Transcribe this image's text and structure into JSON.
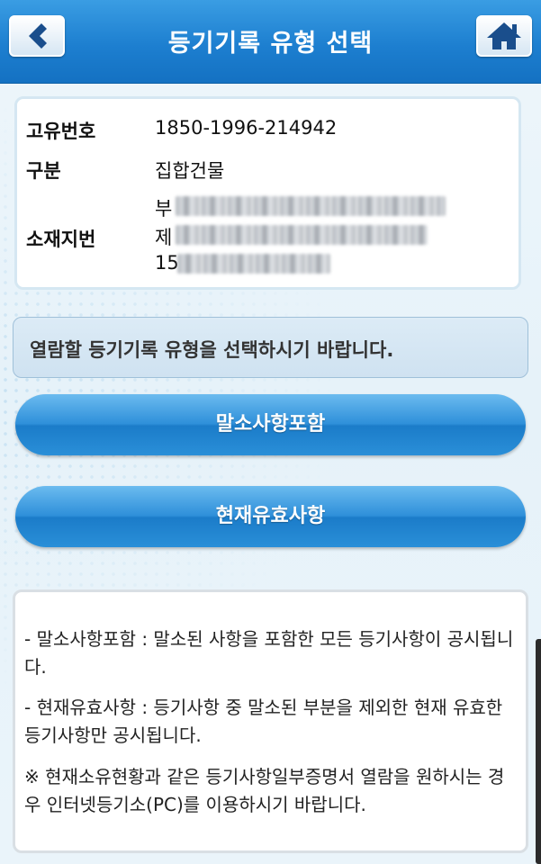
{
  "header": {
    "title": "등기기록 유형 선택",
    "back_icon": "chevron-left-icon",
    "home_icon": "home-icon"
  },
  "info": {
    "id_label": "고유번호",
    "id_value": "1850-1996-214942",
    "type_label": "구분",
    "type_value": "집합건물",
    "address_label": "소재지번",
    "address_line1_prefix": "부",
    "address_line2_prefix": "제",
    "address_line3_prefix": "15"
  },
  "notice": {
    "text": "열람할 등기기록 유형을 선택하시기 바랍니다."
  },
  "buttons": {
    "include_cancelled": "말소사항포함",
    "current_valid": "현재유효사항"
  },
  "description": {
    "para1": "- 말소사항포함 : 말소된 사항을 포함한 모든 등기사항이 공시됩니다.",
    "para2": "- 현재유효사항 : 등기사항 중 말소된 부분을 제외한 현재 유효한 등기사항만 공시됩니다.",
    "para3": "※ 현재소유현황과 같은 등기사항일부증명서 열람을 원하시는 경우 인터넷등기소(PC)를 이용하시기 바랍니다."
  },
  "colors": {
    "header_blue": "#1d7fd0",
    "button_blue": "#2f90da",
    "back_arrow": "#1a4e8c"
  }
}
